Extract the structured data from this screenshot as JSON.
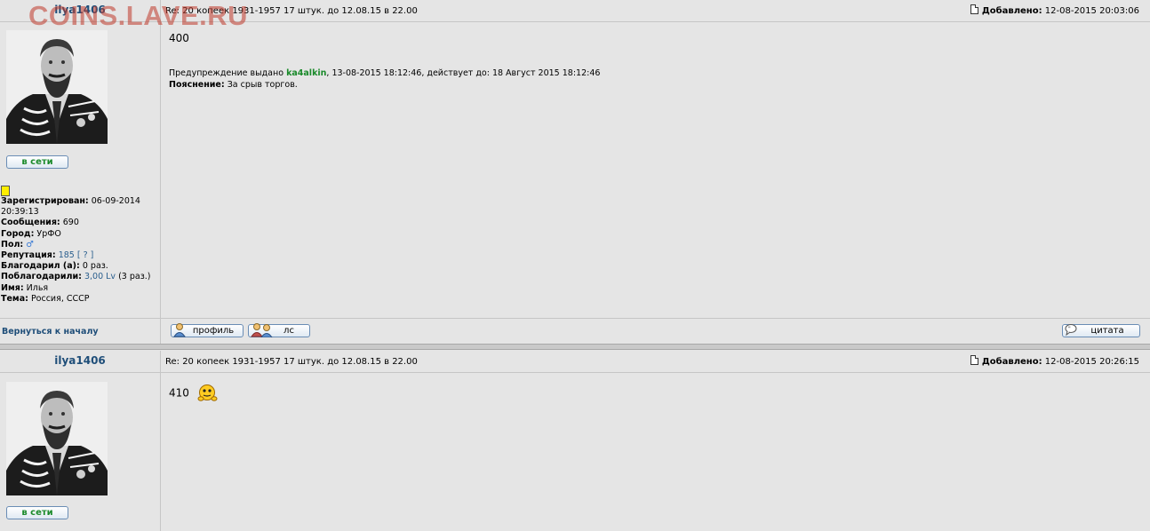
{
  "watermark": "COINS.LAVE.RU",
  "posts": [
    {
      "author": "ilya1406",
      "subject": "Re: 20 копеек 1931-1957 17 штук. до 12.08.15 в 22.00",
      "added_label": "Добавлено:",
      "added_date": "12-08-2015 20:03:06",
      "status": "в сети",
      "body": "400",
      "warning": {
        "prefix": "Предупреждение выдано",
        "moderator": "ka4alkin",
        "details": ", 13-08-2015 18:12:46, действует до: 18 Август 2015 18:12:46",
        "reason_label": "Пояснение:",
        "reason": "За срыв торгов."
      },
      "info": {
        "registered_label": "Зарегистрирован:",
        "registered": "06-09-2014 20:39:13",
        "messages_label": "Сообщения:",
        "messages": "690",
        "city_label": "Город:",
        "city": "УрФО",
        "gender_label": "Пол:",
        "gender_icon": "male-icon",
        "reputation_label": "Репутация:",
        "reputation": "185",
        "reputation_help": "[ ? ]",
        "thanked_label": "Благодарил (а):",
        "thanked": "0 раз.",
        "thanked_by_label": "Поблагодарили:",
        "thanked_by_value": "3,00 Lv",
        "thanked_by_count": "(3 раз.)",
        "name_label": "Имя:",
        "name": "Илья",
        "theme_label": "Тема:",
        "theme": "Россия, СССР"
      },
      "footer": {
        "back": "Вернуться к началу",
        "profile": "профиль",
        "pm": "лс",
        "quote": "цитата"
      }
    },
    {
      "author": "ilya1406",
      "subject": "Re: 20 копеек 1931-1957 17 штук. до 12.08.15 в 22.00",
      "added_label": "Добавлено:",
      "added_date": "12-08-2015 20:26:15",
      "status": "в сети",
      "body": "410"
    }
  ],
  "colors": {
    "accent": "#1f4e79",
    "online": "#1a8a2a",
    "link": "#2b5f8e",
    "warning_user": "#1a8a2a",
    "watermark": "#c0392b"
  }
}
